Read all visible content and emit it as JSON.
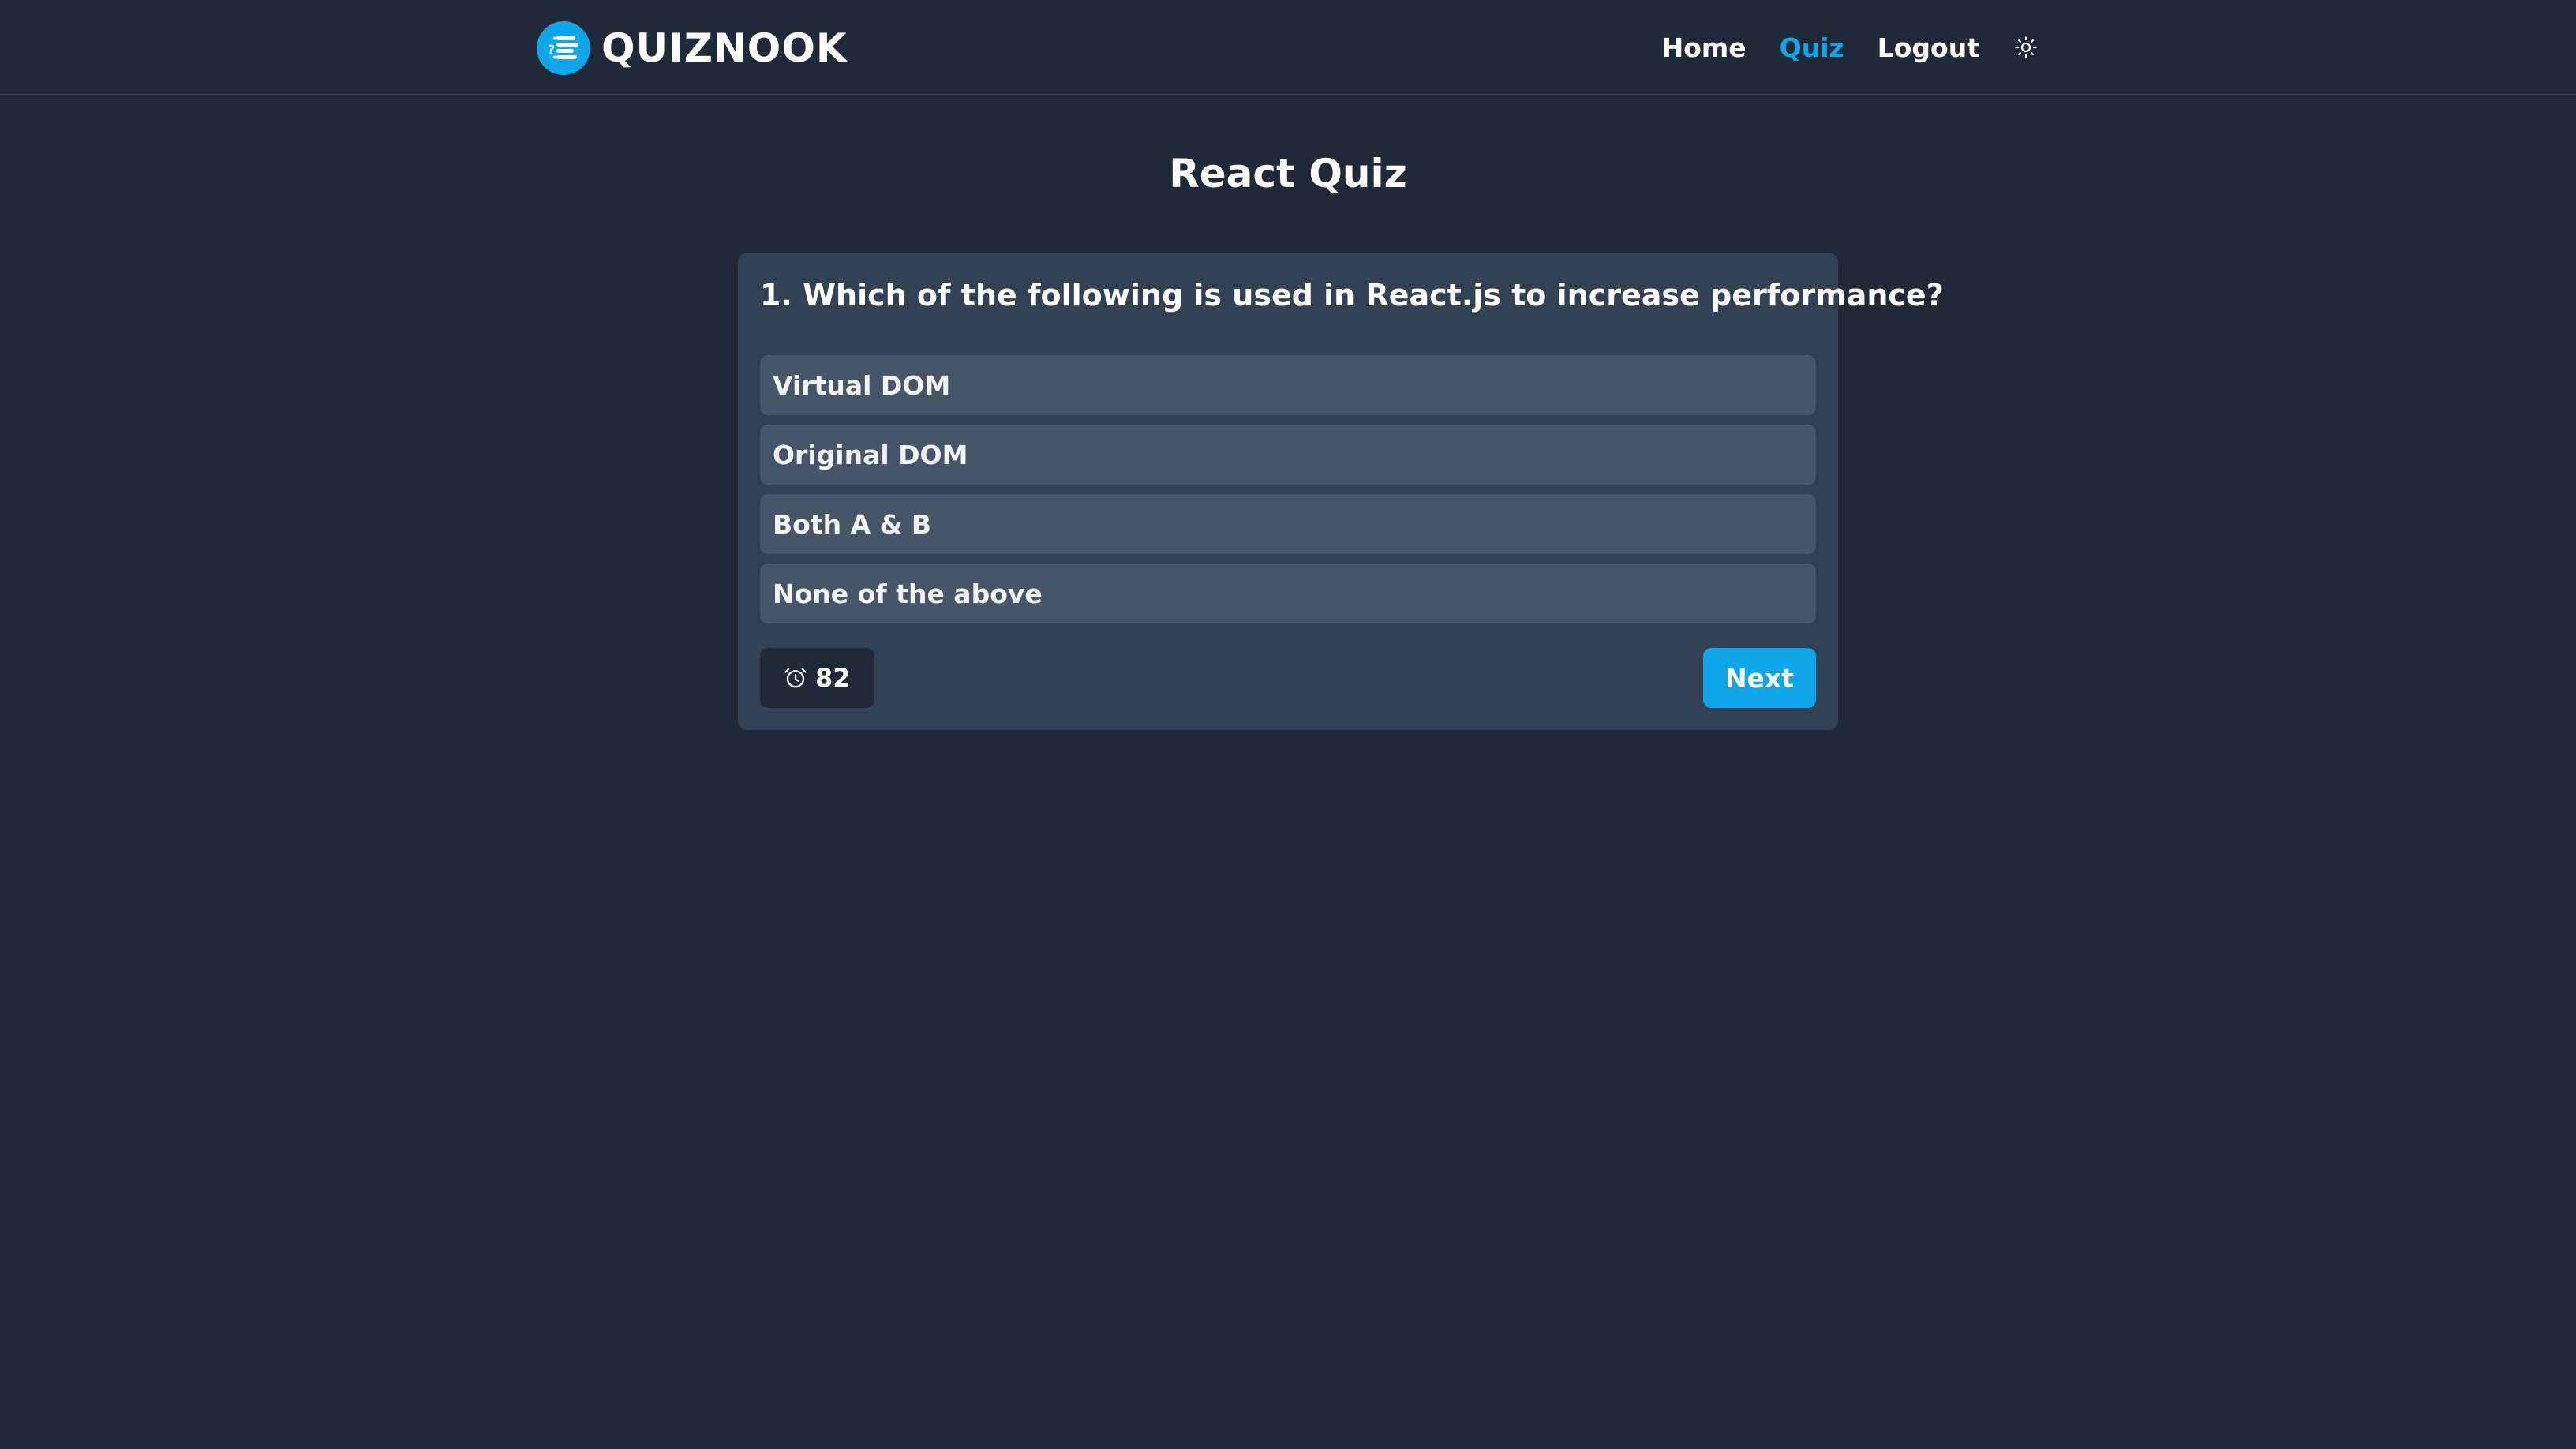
{
  "app": {
    "name": "QUIZNOOK",
    "logo_icon": "quiz-list-icon",
    "accent_color": "#0ea5e9",
    "background_color": "#1f2937"
  },
  "nav": {
    "items": [
      {
        "label": "Home",
        "active": false
      },
      {
        "label": "Quiz",
        "active": true
      },
      {
        "label": "Logout",
        "active": false
      }
    ],
    "theme_toggle_icon": "sun-icon"
  },
  "page": {
    "title": "React Quiz"
  },
  "quiz": {
    "question": "1. Which of the following is used in React.js to increase performance?",
    "options": [
      "Virtual DOM",
      "Original DOM",
      "Both A & B",
      "None of the above"
    ],
    "timer_icon": "alarm-clock-icon",
    "timer_value": "82",
    "next_label": "Next"
  }
}
